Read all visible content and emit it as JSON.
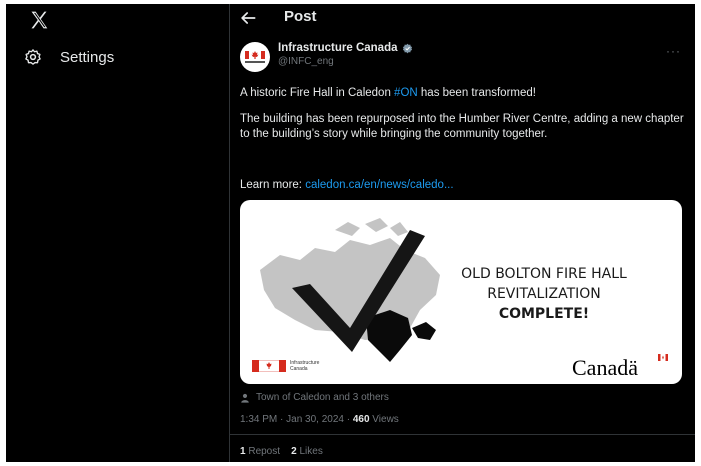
{
  "sidebar": {
    "settings_label": "Settings"
  },
  "header": {
    "title": "Post"
  },
  "author": {
    "name": "Infrastructure Canada",
    "handle": "@INFC_eng"
  },
  "tweet": {
    "line1_pre": "A historic Fire Hall in Caledon ",
    "line1_hashtag": "#ON",
    "line1_post": " has been transformed!",
    "para2": "The building has been repurposed into the Humber River Centre, adding a new chapter to the building’s story while bringing the community together.",
    "learn_label": "Learn more: ",
    "learn_link": "caledon.ca/en/news/caledo..."
  },
  "media": {
    "line1": "OLD BOLTON FIRE HALL",
    "line2": "REVITALIZATION",
    "line3": "COMPLETE!",
    "brand": "Canadä",
    "logo_text_1": "Infrastructure",
    "logo_text_2": "Canada"
  },
  "meta": {
    "tagged": "Town of Caledon and 3 others",
    "time": "1:34 PM · Jan 30, 2024 · ",
    "views_count": "460",
    "views_label": " Views"
  },
  "stats": {
    "reposts_count": "1",
    "reposts_label": " Repost",
    "likes_count": "2",
    "likes_label": " Likes"
  },
  "colors": {
    "background": "#000000",
    "accent": "#1d9bf0",
    "muted": "#71767b",
    "text": "#e7e9ea",
    "canada_red": "#d52b1e"
  }
}
